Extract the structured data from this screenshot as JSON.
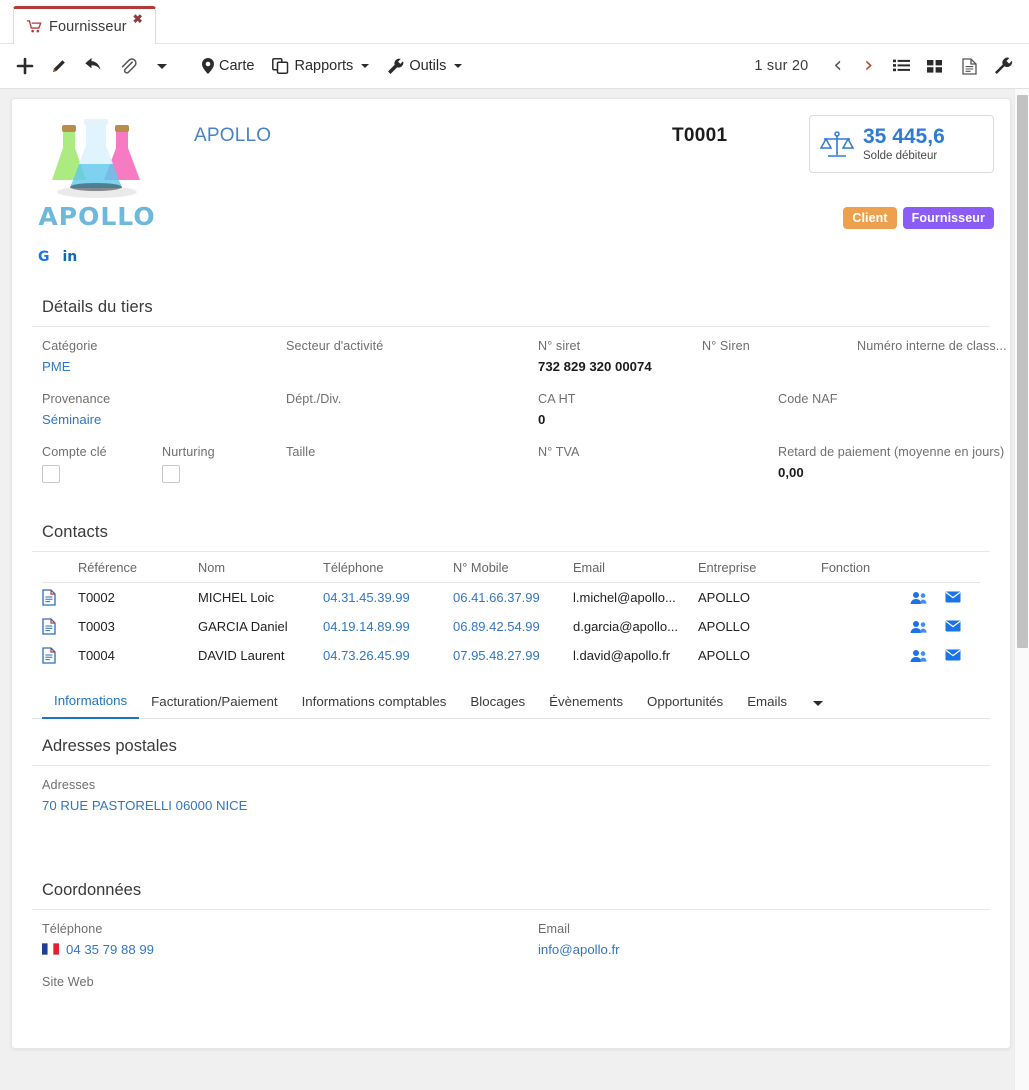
{
  "tab": {
    "label": "Fournisseur",
    "icon": "shopping-cart-icon",
    "close": "✖",
    "accent": "#b33a3a"
  },
  "toolbar": {
    "add": "+",
    "edit_icon": "pencil-icon",
    "reply_icon": "reply-arrow-icon",
    "attach_icon": "paperclip-icon",
    "more_icon": "chevron-down-icon",
    "carte": "Carte",
    "rapports": "Rapports",
    "outils": "Outils",
    "pager": "1 sur 20",
    "prev": "‹",
    "next": "›",
    "list_view_icon": "list-view-icon",
    "grid_view_icon": "grid-view-icon",
    "doc_view_icon": "document-view-icon",
    "wrench_icon": "wrench-icon"
  },
  "identity": {
    "logo_word": "APOLLO",
    "company_name": "APOLLO",
    "reference": "T0001",
    "socials": [
      {
        "name": "google-icon",
        "glyph": "G"
      },
      {
        "name": "linkedin-icon",
        "glyph": "in"
      }
    ],
    "balance": {
      "icon": "balance-scale-icon",
      "amount": "35 445,6",
      "label": "Solde débiteur",
      "color": "#2e7bd4"
    },
    "badges": [
      {
        "label": "Client",
        "color": "#eda14e"
      },
      {
        "label": "Fournisseur",
        "color": "#8b5cf6"
      }
    ]
  },
  "details": {
    "title": "Détails du tiers",
    "rows": [
      [
        {
          "label": "Catégorie",
          "value": "PME",
          "style": "link"
        },
        {
          "label": "Secteur d'activité",
          "value": ""
        },
        {
          "label": "N° siret",
          "value": "732 829 320 00074",
          "style": "bold"
        },
        {
          "label": "N° Siren",
          "value": ""
        },
        {
          "label": "Numéro interne de class...",
          "value": ""
        }
      ],
      [
        {
          "label": "Provenance",
          "value": "Séminaire",
          "style": "link"
        },
        {
          "label": "Dépt./Div.",
          "value": ""
        },
        {
          "label": "CA HT",
          "value": "0",
          "style": "bold"
        },
        {
          "label": "Code NAF",
          "value": ""
        }
      ],
      [
        {
          "label": "Compte clé",
          "value": "",
          "style": "checkbox"
        },
        {
          "label": "Nurturing",
          "value": "",
          "style": "checkbox"
        },
        {
          "label": "Taille",
          "value": ""
        },
        {
          "label": "N° TVA",
          "value": ""
        },
        {
          "label": "Retard de paiement (moyenne en jours)",
          "value": "0,00",
          "style": "bold"
        }
      ]
    ]
  },
  "contacts": {
    "title": "Contacts",
    "columns": [
      "",
      "Référence",
      "Nom",
      "Téléphone",
      "N° Mobile",
      "Email",
      "Entreprise",
      "Fonction",
      ""
    ],
    "rows": [
      {
        "icon": "document-icon",
        "reference": "T0002",
        "nom": "MICHEL Loic",
        "telephone": "04.31.45.39.99",
        "mobile": "06.41.66.37.99",
        "email": "l.michel@apollo...",
        "entreprise": "APOLLO",
        "fonction": "",
        "actions": [
          "contacts-group-icon",
          "envelope-icon"
        ]
      },
      {
        "icon": "document-icon",
        "reference": "T0003",
        "nom": "GARCIA Daniel",
        "telephone": "04.19.14.89.99",
        "mobile": "06.89.42.54.99",
        "email": "d.garcia@apollo...",
        "entreprise": "APOLLO",
        "fonction": "",
        "actions": [
          "contacts-group-icon",
          "envelope-icon"
        ]
      },
      {
        "icon": "document-icon",
        "reference": "T0004",
        "nom": "DAVID Laurent",
        "telephone": "04.73.26.45.99",
        "mobile": "07.95.48.27.99",
        "email": "l.david@apollo.fr",
        "entreprise": "APOLLO",
        "fonction": "",
        "actions": [
          "contacts-group-icon",
          "envelope-icon"
        ]
      }
    ]
  },
  "nav_tabs": {
    "items": [
      {
        "label": "Informations",
        "active": true
      },
      {
        "label": "Facturation/Paiement",
        "active": false
      },
      {
        "label": "Informations comptables",
        "active": false
      },
      {
        "label": "Blocages",
        "active": false
      },
      {
        "label": "Évènements",
        "active": false
      },
      {
        "label": "Opportunités",
        "active": false
      },
      {
        "label": "Emails",
        "active": false
      }
    ],
    "overflow_icon": "chevron-down-icon"
  },
  "addresses": {
    "title": "Adresses postales",
    "label": "Adresses",
    "value": "70 RUE PASTORELLI 06000 NICE"
  },
  "coordinates": {
    "title": "Coordonnées",
    "phone_label": "Téléphone",
    "phone_value": "04 35 79 88 99",
    "phone_flag": "france-flag-icon",
    "email_label": "Email",
    "email_value": "info@apollo.fr",
    "website_label": "Site Web",
    "website_value": ""
  }
}
